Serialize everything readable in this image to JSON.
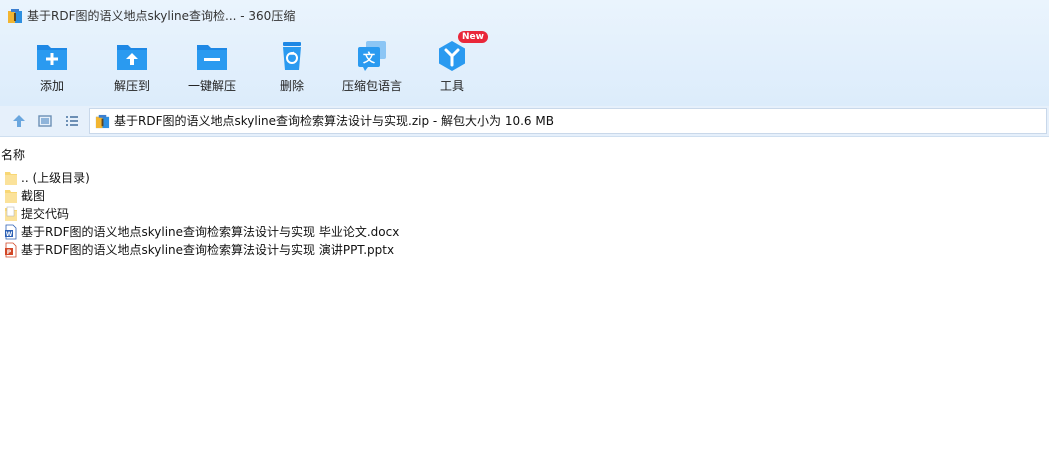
{
  "window": {
    "title": "基于RDF图的语义地点skyline查询检... - 360压缩",
    "app_icon": "archive-icon"
  },
  "toolbar": {
    "items": [
      {
        "label": "添加",
        "icon": "add-icon"
      },
      {
        "label": "解压到",
        "icon": "extract-to-icon"
      },
      {
        "label": "一键解压",
        "icon": "quick-extract-icon"
      },
      {
        "label": "删除",
        "icon": "delete-icon"
      },
      {
        "label": "压缩包语言",
        "icon": "language-icon"
      },
      {
        "label": "工具",
        "icon": "tools-icon",
        "badge": "New"
      }
    ]
  },
  "addressbar": {
    "path": "基于RDF图的语义地点skyline查询检索算法设计与实现.zip - 解包大小为 10.6 MB"
  },
  "filelist": {
    "column_name": "名称",
    "items": [
      {
        "name": ".. (上级目录)",
        "type": "parent-folder",
        "icon": "folder-icon"
      },
      {
        "name": "截图",
        "type": "folder",
        "icon": "folder-icon"
      },
      {
        "name": "提交代码",
        "type": "folder",
        "icon": "folder-file-icon"
      },
      {
        "name": "基于RDF图的语义地点skyline查询检索算法设计与实现 毕业论文.docx",
        "type": "docx",
        "icon": "word-document-icon"
      },
      {
        "name": "基于RDF图的语义地点skyline查询检索算法设计与实现 演讲PPT.pptx",
        "type": "pptx",
        "icon": "powerpoint-document-icon"
      }
    ]
  },
  "colors": {
    "accent": "#2e8fe0",
    "toolbar_bg": "#e1eefb",
    "badge": "#e9273a",
    "folder": "#f8d775"
  }
}
